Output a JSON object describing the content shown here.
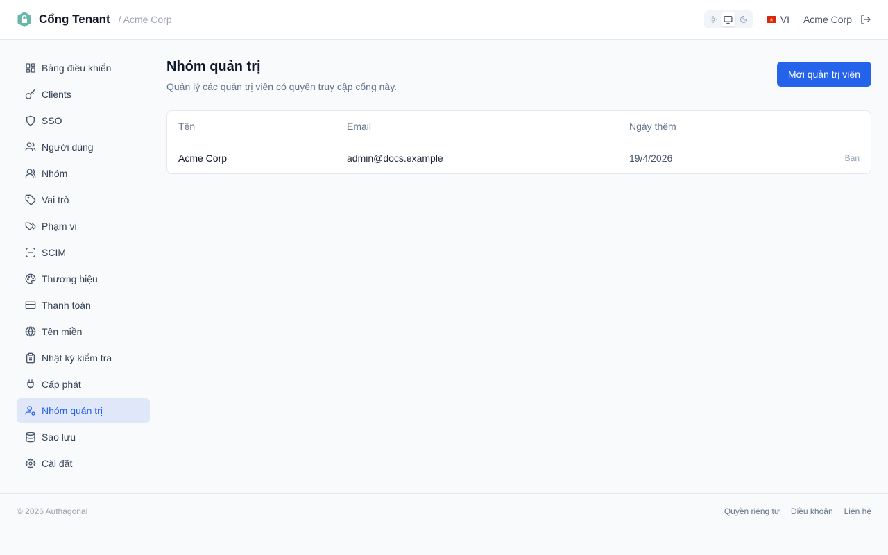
{
  "header": {
    "app_title": "Cổng Tenant",
    "breadcrumb": "/ Acme Corp",
    "language": "VI",
    "user_name": "Acme Corp",
    "brand_color": "#5fa8a0"
  },
  "sidebar": {
    "items": [
      {
        "label": "Bảng điều khiển",
        "icon": "dashboard-icon"
      },
      {
        "label": "Clients",
        "icon": "key-icon"
      },
      {
        "label": "SSO",
        "icon": "shield-icon"
      },
      {
        "label": "Người dùng",
        "icon": "users-icon"
      },
      {
        "label": "Nhóm",
        "icon": "group-icon"
      },
      {
        "label": "Vai trò",
        "icon": "tag-icon"
      },
      {
        "label": "Phạm vi",
        "icon": "tags-icon"
      },
      {
        "label": "SCIM",
        "icon": "scan-icon"
      },
      {
        "label": "Thương hiệu",
        "icon": "palette-icon"
      },
      {
        "label": "Thanh toán",
        "icon": "credit-card-icon"
      },
      {
        "label": "Tên miền",
        "icon": "globe-icon"
      },
      {
        "label": "Nhật ký kiểm tra",
        "icon": "clipboard-icon"
      },
      {
        "label": "Cấp phát",
        "icon": "plug-icon"
      },
      {
        "label": "Nhóm quản trị",
        "icon": "user-cog-icon",
        "active": true
      },
      {
        "label": "Sao lưu",
        "icon": "database-icon"
      },
      {
        "label": "Cài đặt",
        "icon": "gear-icon"
      }
    ]
  },
  "main": {
    "title": "Nhóm quản trị",
    "subtitle": "Quản lý các quản trị viên có quyền truy cập cổng này.",
    "invite_label": "Mời quản trị viên",
    "accent_color": "#2563eb",
    "table": {
      "columns": [
        "Tên",
        "Email",
        "Ngày thêm"
      ],
      "rows": [
        {
          "name": "Acme Corp",
          "email": "admin@docs.example",
          "date": "19/4/2026",
          "badge": "Bạn"
        }
      ]
    }
  },
  "footer": {
    "copyright": "© 2026 Authagonal",
    "links": [
      "Quyền riêng tư",
      "Điều khoản",
      "Liên hệ"
    ]
  }
}
